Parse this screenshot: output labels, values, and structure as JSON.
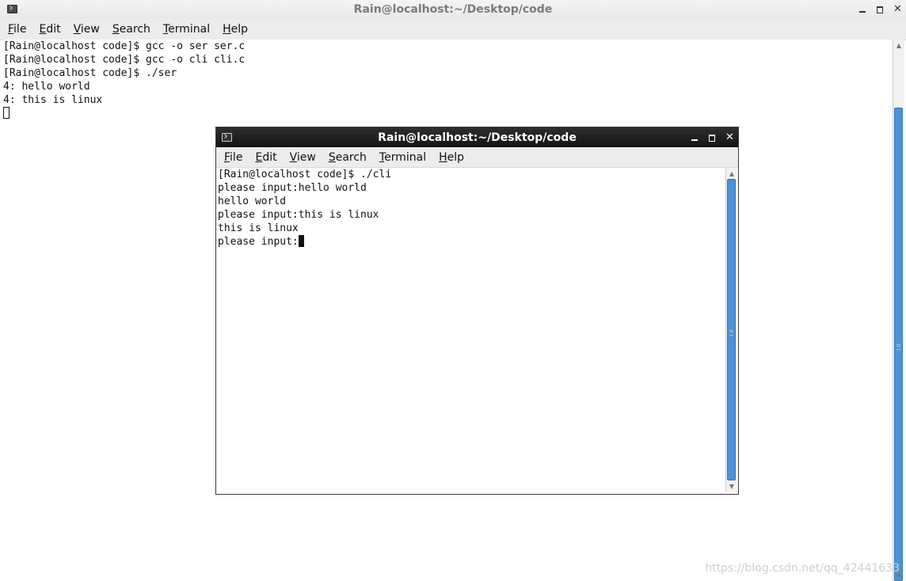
{
  "main_window": {
    "title": "Rain@localhost:~/Desktop/code",
    "menu": [
      {
        "mnemonic": "F",
        "rest": "ile"
      },
      {
        "mnemonic": "E",
        "rest": "dit"
      },
      {
        "mnemonic": "V",
        "rest": "iew"
      },
      {
        "mnemonic": "S",
        "rest": "earch"
      },
      {
        "mnemonic": "T",
        "rest": "erminal"
      },
      {
        "mnemonic": "H",
        "rest": "elp"
      }
    ],
    "lines": [
      "[Rain@localhost code]$ gcc -o ser ser.c",
      "[Rain@localhost code]$ gcc -o cli cli.c",
      "[Rain@localhost code]$ ./ser",
      "4: hello world",
      "4: this is linux"
    ]
  },
  "cli_window": {
    "title": "Rain@localhost:~/Desktop/code",
    "menu": [
      {
        "mnemonic": "F",
        "rest": "ile"
      },
      {
        "mnemonic": "E",
        "rest": "dit"
      },
      {
        "mnemonic": "V",
        "rest": "iew"
      },
      {
        "mnemonic": "S",
        "rest": "earch"
      },
      {
        "mnemonic": "T",
        "rest": "erminal"
      },
      {
        "mnemonic": "H",
        "rest": "elp"
      }
    ],
    "lines": [
      "[Rain@localhost code]$ ./cli",
      "please input:hello world",
      "hello world",
      "please input:this is linux",
      "this is linux"
    ],
    "prompt_line": "please input:"
  },
  "watermark": "https://blog.csdn.net/qq_42441633",
  "icons": {
    "window_icon": "terminal-icon",
    "minimize": "minimize-icon",
    "maximize": "maximize-icon",
    "close": "close-icon",
    "scroll_up": "scroll-up-arrow-icon",
    "scroll_down": "scroll-down-arrow-icon"
  },
  "colors": {
    "scroll_thumb": "#4c92d6",
    "active_titlebar": "#1f1f1f",
    "inactive_title_text": "#7a7a7a"
  }
}
